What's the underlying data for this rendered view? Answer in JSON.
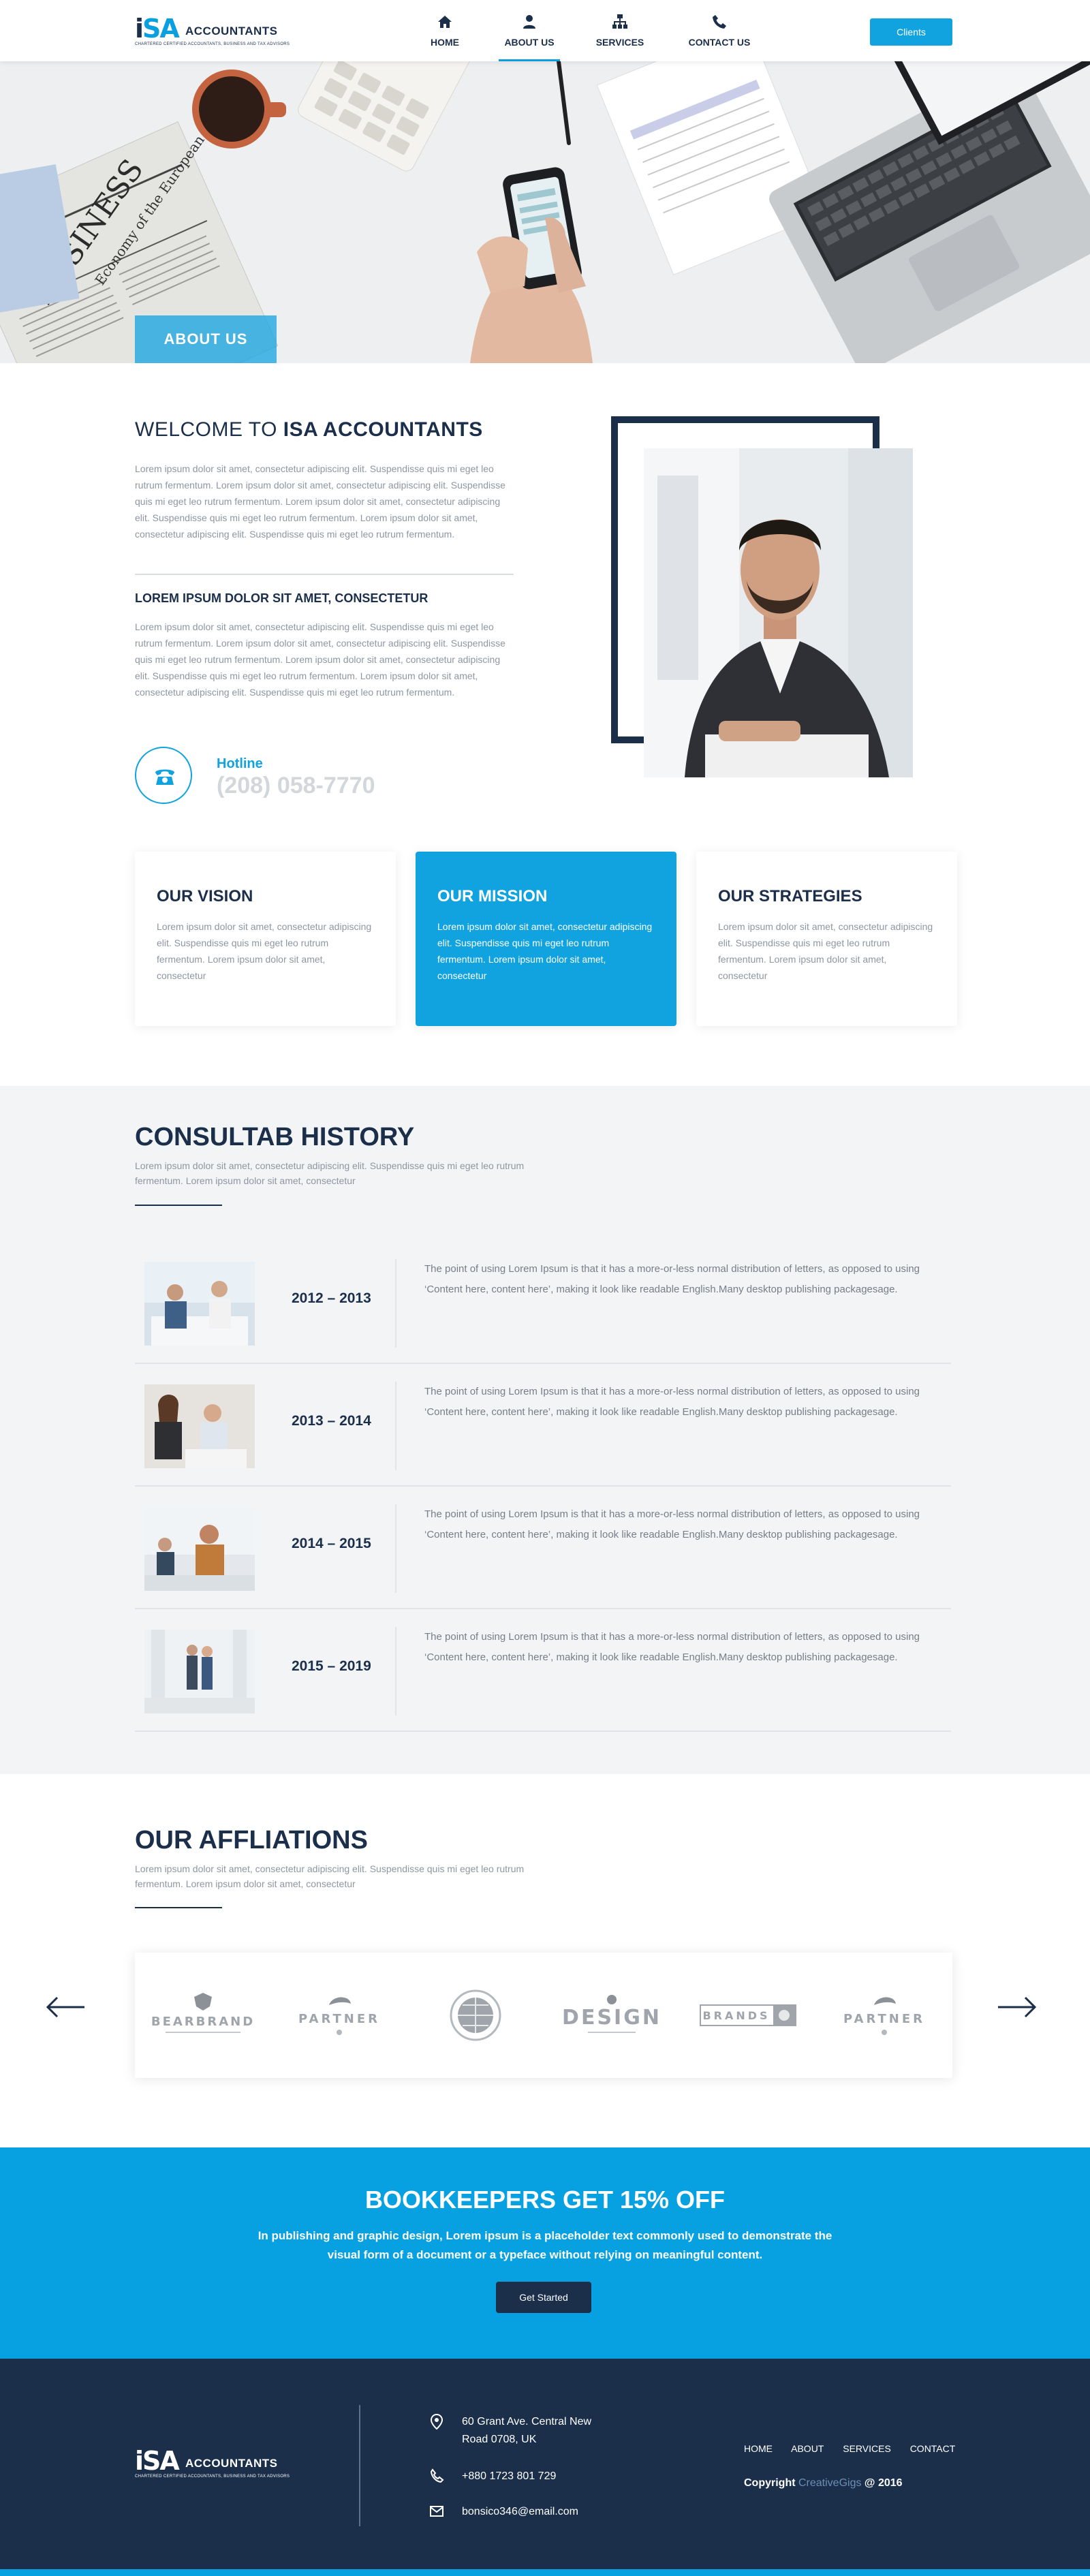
{
  "brand": {
    "logo_mark_i": "i",
    "logo_mark_sa": "SA",
    "logo_word": "ACCOUNTANTS",
    "tagline": "CHARTERED CERTIFIED ACCOUNTANTS, BUSINESS AND TAX ADVISORS"
  },
  "nav": {
    "items": [
      {
        "label": "HOME",
        "icon": "home-icon",
        "active": false
      },
      {
        "label": "ABOUT US",
        "icon": "user-icon",
        "active": true
      },
      {
        "label": "SERVICES",
        "icon": "sitemap-icon",
        "active": false
      },
      {
        "label": "CONTACT US",
        "icon": "phone-icon",
        "active": false
      }
    ],
    "clients_button": "Clients"
  },
  "hero": {
    "tag": "ABOUT US",
    "newspaper_word": "BUSINESS",
    "newspaper_line": "Economy of the European Union"
  },
  "welcome": {
    "title_light": "WELCOME TO ",
    "title_bold": "ISA ACCOUNTANTS",
    "para1": "Lorem ipsum dolor sit amet, consectetur adipiscing elit. Suspendisse quis mi eget leo rutrum fermentum. Lorem ipsum dolor sit amet, consectetur adipiscing elit. Suspendisse quis mi eget leo rutrum fermentum. Lorem ipsum dolor sit amet, consectetur adipiscing elit. Suspendisse quis mi eget leo rutrum fermentum. Lorem ipsum dolor sit amet, consectetur adipiscing elit. Suspendisse quis mi eget leo rutrum fermentum.",
    "subtitle": "LOREM IPSUM DOLOR SIT AMET, CONSECTETUR",
    "para2": "Lorem ipsum dolor sit amet, consectetur adipiscing elit. Suspendisse quis mi eget leo rutrum fermentum. Lorem ipsum dolor sit amet, consectetur adipiscing elit. Suspendisse quis mi eget leo rutrum fermentum. Lorem ipsum dolor sit amet, consectetur adipiscing elit. Suspendisse quis mi eget leo rutrum fermentum. Lorem ipsum dolor sit amet, consectetur adipiscing elit. Suspendisse quis mi eget leo rutrum fermentum.",
    "hotline_label": "Hotline",
    "hotline_number": "(208) 058-7770"
  },
  "cards": [
    {
      "title": "OUR VISION",
      "text": "Lorem ipsum dolor sit amet, consectetur adipiscing elit. Suspendisse quis mi eget leo rutrum fermentum. Lorem ipsum dolor sit amet, consectetur"
    },
    {
      "title": "OUR MISSION",
      "text": "Lorem ipsum dolor sit amet, consectetur adipiscing elit. Suspendisse quis mi eget leo rutrum fermentum. Lorem ipsum dolor sit amet, consectetur"
    },
    {
      "title": "OUR STRATEGIES",
      "text": "Lorem ipsum dolor sit amet, consectetur adipiscing elit. Suspendisse quis mi eget leo rutrum fermentum. Lorem ipsum dolor sit amet, consectetur"
    }
  ],
  "history": {
    "title": "CONSULTAB HISTORY",
    "subtitle": "Lorem ipsum dolor sit amet, consectetur adipiscing elit. Suspendisse quis mi eget leo rutrum fermentum. Lorem ipsum dolor sit amet, consectetur",
    "rows": [
      {
        "years": "2012 – 2013",
        "text": "The point of using Lorem Ipsum is that it has a more-or-less normal distribution of letters, as opposed to using ‘Content here, content here’, making it look like readable English.Many desktop publishing packagesage."
      },
      {
        "years": "2013 – 2014",
        "text": "The point of using Lorem Ipsum is that it has a more-or-less normal distribution of letters, as opposed to using ‘Content here, content here’, making it look like readable English.Many desktop publishing packagesage."
      },
      {
        "years": "2014 – 2015",
        "text": "The point of using Lorem Ipsum is that it has a more-or-less normal distribution of letters, as opposed to using ‘Content here, content here’, making it look like readable English.Many desktop publishing packagesage."
      },
      {
        "years": "2015 – 2019",
        "text": "The point of using Lorem Ipsum is that it has a more-or-less normal distribution of letters, as opposed to using ‘Content here, content here’, making it look like readable English.Many desktop publishing packagesage."
      }
    ]
  },
  "affiliations": {
    "title": "OUR AFFLIATIONS",
    "subtitle": "Lorem ipsum dolor sit amet, consectetur adipiscing elit. Suspendisse quis mi eget leo rutrum fermentum. Lorem ipsum dolor sit amet, consectetur",
    "logos": [
      "BEARBRAND",
      "PARTNER",
      "",
      "DESIGN",
      "BRANDS",
      "PARTNER"
    ]
  },
  "promo": {
    "title": "BOOKKEEPERS GET 15% OFF",
    "text": "In publishing and graphic design, Lorem ipsum is a placeholder text commonly used to demonstrate the visual form of a document or a typeface without relying on meaningful content.",
    "button": "Get Started"
  },
  "footer": {
    "address_line1": "60 Grant Ave. Central New",
    "address_line2": "Road 0708, UK",
    "phone": "+880 1723 801 729",
    "email": "bonsico346@email.com",
    "nav": [
      "HOME",
      "ABOUT",
      "SERVICES",
      "CONTACT"
    ],
    "copy_prefix": "Copyright ",
    "copy_brand": "CreativeGigs",
    "copy_suffix": " @ 2016"
  },
  "colors": {
    "primary": "#1b2f4b",
    "accent": "#10a3e0",
    "muted": "#8f96a0"
  }
}
